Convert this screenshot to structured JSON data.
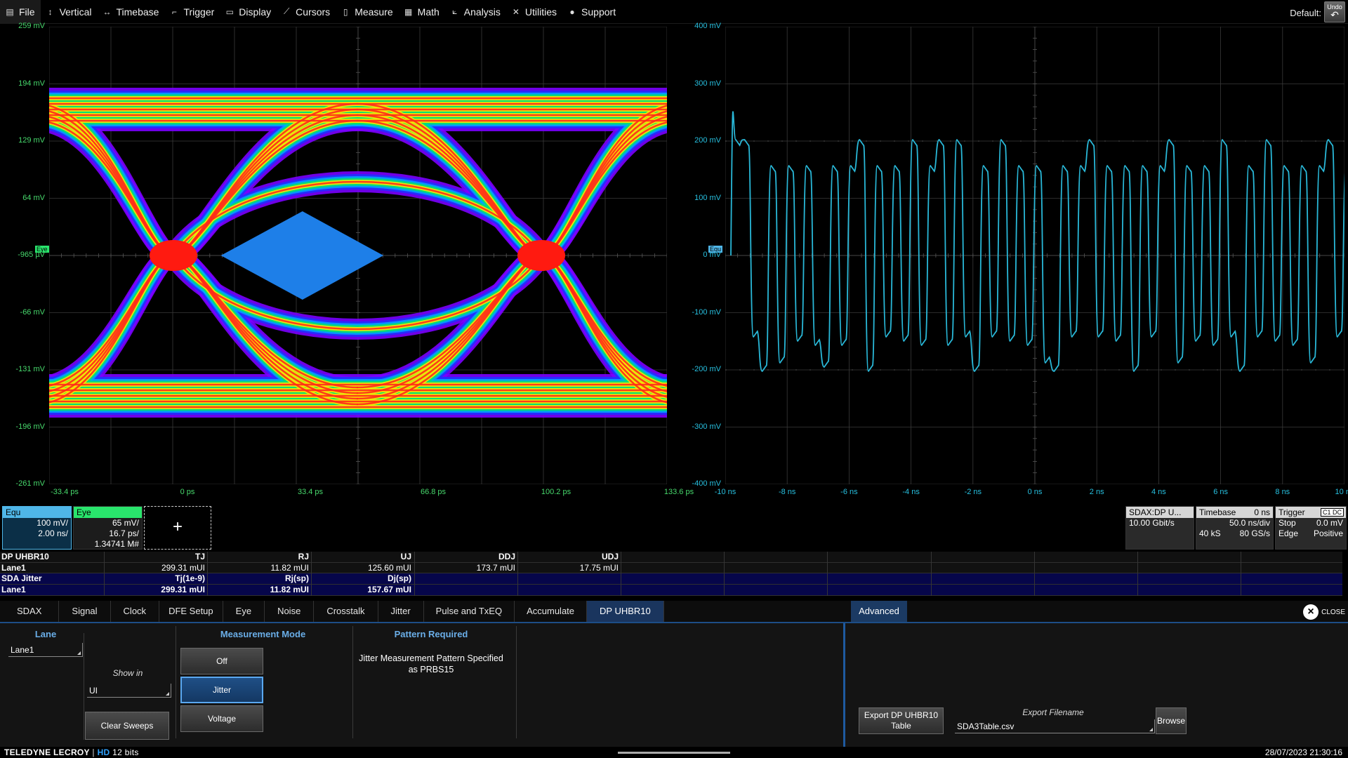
{
  "menu": [
    {
      "label": "File",
      "icon": "file-icon"
    },
    {
      "label": "Vertical",
      "icon": "vertical-arrows-icon"
    },
    {
      "label": "Timebase",
      "icon": "horizontal-arrows-icon"
    },
    {
      "label": "Trigger",
      "icon": "trigger-icon"
    },
    {
      "label": "Display",
      "icon": "display-icon"
    },
    {
      "label": "Cursors",
      "icon": "cursor-icon"
    },
    {
      "label": "Measure",
      "icon": "measure-icon"
    },
    {
      "label": "Math",
      "icon": "math-icon"
    },
    {
      "label": "Analysis",
      "icon": "analysis-icon"
    },
    {
      "label": "Utilities",
      "icon": "wrench-icon"
    },
    {
      "label": "Support",
      "icon": "help-icon"
    }
  ],
  "default_label": "Default:",
  "undo_label": "Undo",
  "eye_graph": {
    "y_labels": [
      "259 mV",
      "194 mV",
      "129 mV",
      "64 mV",
      "-965 µV",
      "-66 mV",
      "-131 mV",
      "-196 mV",
      "-261 mV"
    ],
    "x_labels": [
      "-33.4 ps",
      "0 ps",
      "33.4 ps",
      "66.8 ps",
      "100.2 ps",
      "133.6 ps"
    ],
    "trace_tag": "Eye",
    "colors": {
      "axis": "#47d96c",
      "grid": "#3a3a3a",
      "mask": "#1e7fe8"
    }
  },
  "wave_graph": {
    "y_labels": [
      "400 mV",
      "300 mV",
      "200 mV",
      "100 mV",
      "0 mV",
      "-100 mV",
      "-200 mV",
      "-300 mV",
      "-400 mV"
    ],
    "x_labels": [
      "-10 ns",
      "-8 ns",
      "-6 ns",
      "-4 ns",
      "-2 ns",
      "0 ns",
      "2 ns",
      "4 ns",
      "6 ns",
      "8 ns",
      "10 ns"
    ],
    "trace_tag": "Equ",
    "colors": {
      "trace": "#29b8d8",
      "grid": "#3a3a3a"
    }
  },
  "descriptors": {
    "equ": {
      "name": "Equ",
      "line1": "100 mV/",
      "line2": "2.00 ns/"
    },
    "eye": {
      "name": "Eye",
      "line1": "65 mV/",
      "line2": "16.7 ps/",
      "line3": "1.34741 M#"
    },
    "add_symbol": "+",
    "sdax": {
      "name": "SDAX:DP U...",
      "rate": "10.00 Gbit/s"
    },
    "timebase": {
      "name": "Timebase",
      "delay": "0 ns",
      "per_div": "50.0 ns/div",
      "samples": "40 kS",
      "rate": "80 GS/s"
    },
    "trigger": {
      "name": "Trigger",
      "badge": "C1 DC",
      "mode": "Stop",
      "level": "0.0 mV",
      "type": "Edge",
      "slope": "Positive"
    }
  },
  "results": {
    "row1_header": {
      "name": "DP UHBR10",
      "cols": [
        "TJ",
        "RJ",
        "UJ",
        "DDJ",
        "UDJ"
      ]
    },
    "row1_values": {
      "name": "Lane1",
      "cols": [
        "299.31 mUI",
        "11.82 mUI",
        "125.60 mUI",
        "173.7 mUI",
        "17.75 mUI"
      ]
    },
    "row2_header": {
      "name": "SDA Jitter",
      "cols": [
        "Tj(1e-9)",
        "Rj(sp)",
        "Dj(sp)"
      ]
    },
    "row2_values": {
      "name": "Lane1",
      "cols": [
        "299.31 mUI",
        "11.82 mUI",
        "157.67 mUI"
      ]
    }
  },
  "tabs": [
    "SDAX",
    "Signal",
    "Clock",
    "DFE Setup",
    "Eye",
    "Noise",
    "Crosstalk",
    "Jitter",
    "Pulse and TxEQ",
    "Accumulate",
    "DP UHBR10"
  ],
  "active_tab": "DP UHBR10",
  "advanced_tab": "Advanced",
  "close_label": "CLOSE",
  "dialog": {
    "lane_title": "Lane",
    "lane_value": "Lane1",
    "show_in_label": "Show in",
    "show_in_value": "UI",
    "clear_sweeps": "Clear Sweeps",
    "measurement_mode_title": "Measurement Mode",
    "mode_off": "Off",
    "mode_jitter": "Jitter",
    "mode_voltage": "Voltage",
    "selected_mode": "Jitter",
    "pattern_title": "Pattern Required",
    "pattern_text": "Jitter Measurement Pattern Specified as PRBS15",
    "export_button": "Export DP UHBR10 Table",
    "export_filename_label": "Export Filename",
    "export_filename_value": "SDA3Table.csv",
    "browse_button": "Browse"
  },
  "status": {
    "brand": "TELEDYNE LECROY",
    "hd": "HD",
    "bits": "12 bits",
    "datetime": "28/07/2023 21:30:16"
  }
}
